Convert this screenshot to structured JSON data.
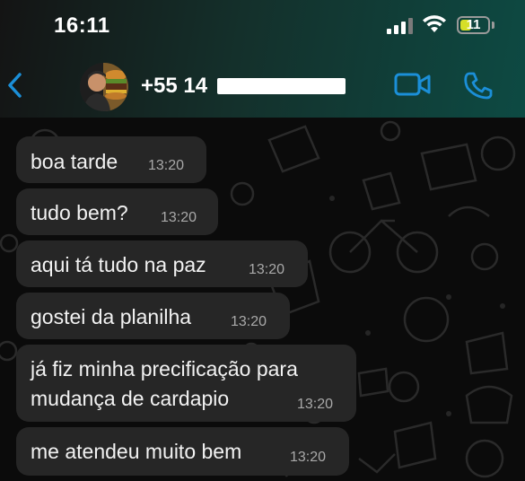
{
  "status_bar": {
    "time": "16:11",
    "battery_level": "11",
    "icons": [
      "signal-icon",
      "wifi-icon",
      "battery-icon"
    ]
  },
  "header": {
    "contact_name": "+55 14",
    "icons": [
      "chevron-left-icon",
      "avatar",
      "video-call-icon",
      "phone-call-icon"
    ],
    "accent_color": "#1b8fd8"
  },
  "messages": [
    {
      "text": "boa tarde",
      "time": "13:20"
    },
    {
      "text": "tudo bem?",
      "time": "13:20"
    },
    {
      "text": "aqui tá tudo na paz",
      "time": "13:20"
    },
    {
      "text": "gostei da planilha",
      "time": "13:20"
    },
    {
      "text": "já fiz minha precificação para",
      "text2": "mudança de cardapio",
      "time": "13:20"
    },
    {
      "text": "me atendeu muito bem",
      "time": "13:20"
    }
  ]
}
